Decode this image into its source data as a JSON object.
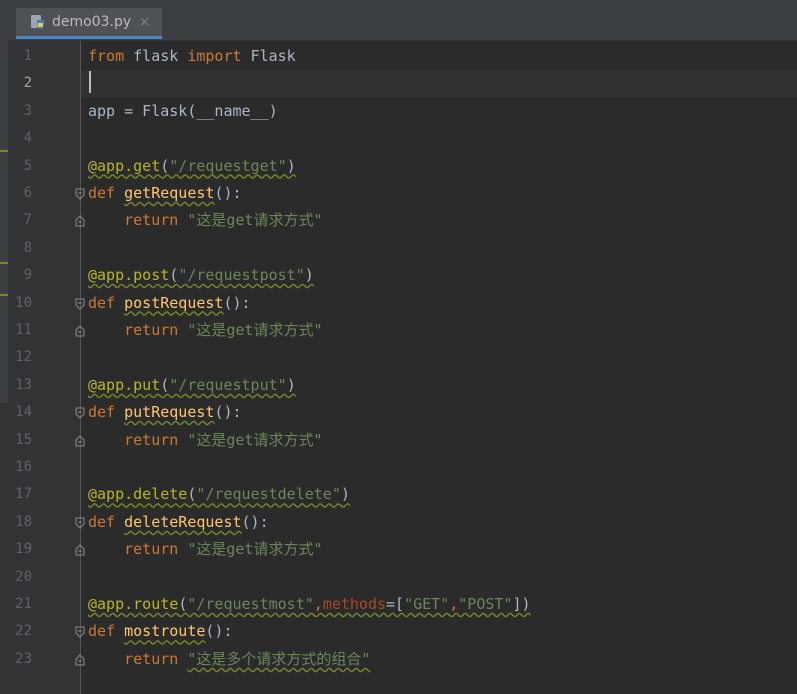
{
  "tab": {
    "label": "demo03.py",
    "close": "×"
  },
  "editor": {
    "current_line": 2,
    "lines": [
      {
        "num": "1",
        "tokens": [
          {
            "t": "from",
            "c": "kw"
          },
          {
            "t": " flask ",
            "c": ""
          },
          {
            "t": "import",
            "c": "kw"
          },
          {
            "t": " Flask",
            "c": ""
          }
        ]
      },
      {
        "num": "2",
        "tokens": []
      },
      {
        "num": "3",
        "tokens": [
          {
            "t": "app = Flask(__name__)",
            "c": ""
          }
        ]
      },
      {
        "num": "4",
        "tokens": []
      },
      {
        "num": "5",
        "tokens": [
          {
            "t": "@app.get",
            "c": "dec warn"
          },
          {
            "t": "(",
            "c": "warn"
          },
          {
            "t": "\"/requestget\"",
            "c": "str warn"
          },
          {
            "t": ")",
            "c": "warn"
          }
        ]
      },
      {
        "num": "6",
        "fold": "open",
        "tokens": [
          {
            "t": "def ",
            "c": "kw"
          },
          {
            "t": "getRequest",
            "c": "fn warn"
          },
          {
            "t": "():",
            "c": ""
          }
        ]
      },
      {
        "num": "7",
        "fold": "close",
        "tokens": [
          {
            "t": "    return ",
            "c": "kw"
          },
          {
            "t": "\"这是get请求方式\"",
            "c": "str"
          }
        ]
      },
      {
        "num": "8",
        "tokens": []
      },
      {
        "num": "9",
        "tokens": [
          {
            "t": "@app.post",
            "c": "dec warn"
          },
          {
            "t": "(",
            "c": "warn"
          },
          {
            "t": "\"/requestpost\"",
            "c": "str warn"
          },
          {
            "t": ")",
            "c": "warn"
          }
        ]
      },
      {
        "num": "10",
        "fold": "open",
        "tokens": [
          {
            "t": "def ",
            "c": "kw"
          },
          {
            "t": "postRequest",
            "c": "fn warn"
          },
          {
            "t": "():",
            "c": ""
          }
        ]
      },
      {
        "num": "11",
        "fold": "close",
        "tokens": [
          {
            "t": "    return ",
            "c": "kw"
          },
          {
            "t": "\"这是get请求方式\"",
            "c": "str"
          }
        ]
      },
      {
        "num": "12",
        "tokens": []
      },
      {
        "num": "13",
        "tokens": [
          {
            "t": "@app.put",
            "c": "dec warn"
          },
          {
            "t": "(",
            "c": "warn"
          },
          {
            "t": "\"/requestput\"",
            "c": "str warn"
          },
          {
            "t": ")",
            "c": "warn"
          }
        ]
      },
      {
        "num": "14",
        "fold": "open",
        "tokens": [
          {
            "t": "def ",
            "c": "kw"
          },
          {
            "t": "putRequest",
            "c": "fn warn"
          },
          {
            "t": "():",
            "c": ""
          }
        ]
      },
      {
        "num": "15",
        "fold": "close",
        "tokens": [
          {
            "t": "    return ",
            "c": "kw"
          },
          {
            "t": "\"这是get请求方式\"",
            "c": "str"
          }
        ]
      },
      {
        "num": "16",
        "tokens": []
      },
      {
        "num": "17",
        "tokens": [
          {
            "t": "@app.delete",
            "c": "dec warn"
          },
          {
            "t": "(",
            "c": "warn"
          },
          {
            "t": "\"/requestdelete\"",
            "c": "str warn"
          },
          {
            "t": ")",
            "c": "warn"
          }
        ]
      },
      {
        "num": "18",
        "fold": "open",
        "tokens": [
          {
            "t": "def ",
            "c": "kw"
          },
          {
            "t": "deleteRequest",
            "c": "fn warn"
          },
          {
            "t": "():",
            "c": ""
          }
        ]
      },
      {
        "num": "19",
        "fold": "close",
        "tokens": [
          {
            "t": "    return ",
            "c": "kw"
          },
          {
            "t": "\"这是get请求方式\"",
            "c": "str"
          }
        ]
      },
      {
        "num": "20",
        "tokens": []
      },
      {
        "num": "21",
        "tokens": [
          {
            "t": "@app.route",
            "c": "dec warn"
          },
          {
            "t": "(",
            "c": "warn"
          },
          {
            "t": "\"/requestmost\"",
            "c": "str warn"
          },
          {
            "t": ",",
            "c": "kw warn"
          },
          {
            "t": "methods",
            "c": "param warn"
          },
          {
            "t": "=[",
            "c": "warn"
          },
          {
            "t": "\"GET\"",
            "c": "str warn"
          },
          {
            "t": ",",
            "c": "kw warn"
          },
          {
            "t": "\"POST\"",
            "c": "str warn"
          },
          {
            "t": "])",
            "c": "warn"
          }
        ]
      },
      {
        "num": "22",
        "fold": "open",
        "tokens": [
          {
            "t": "def ",
            "c": "kw"
          },
          {
            "t": "mostroute",
            "c": "fn warn"
          },
          {
            "t": "():",
            "c": ""
          }
        ]
      },
      {
        "num": "23",
        "fold": "close",
        "tokens": [
          {
            "t": "    return ",
            "c": "kw"
          },
          {
            "t": "\"这是多个请求方式的组合\"",
            "c": "str warn"
          }
        ]
      }
    ]
  },
  "colors": {
    "background": "#2b2b2b",
    "keyword": "#cc7832",
    "decorator": "#bbb529",
    "string": "#6a8759",
    "function": "#ffc66d",
    "param": "#aa4926",
    "text": "#a9b7c6"
  },
  "icons": {
    "tab_file": "python-file-icon",
    "fold_open": "fold-open-icon",
    "fold_close": "fold-close-icon"
  }
}
